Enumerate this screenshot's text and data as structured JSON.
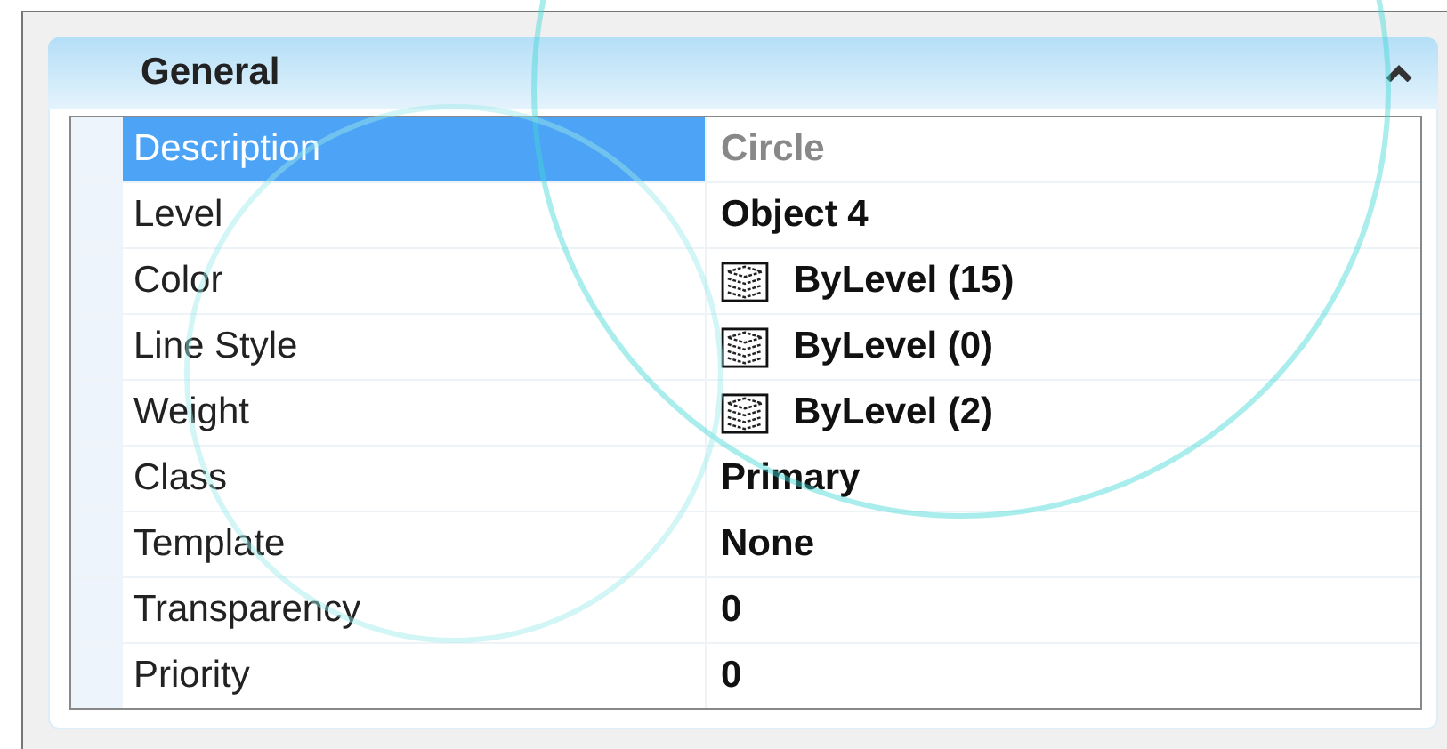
{
  "section": {
    "title": "General",
    "expanded": true
  },
  "properties": [
    {
      "label": "Description",
      "value": "Circle",
      "selected": true,
      "disabled": true,
      "kind": "text"
    },
    {
      "label": "Level",
      "value": "Object 4",
      "selected": false,
      "disabled": false,
      "kind": "text"
    },
    {
      "label": "Color",
      "value": "ByLevel (15)",
      "selected": false,
      "disabled": false,
      "kind": "bylevel"
    },
    {
      "label": "Line Style",
      "value": "ByLevel (0)",
      "selected": false,
      "disabled": false,
      "kind": "bylevel"
    },
    {
      "label": "Weight",
      "value": "ByLevel (2)",
      "selected": false,
      "disabled": false,
      "kind": "bylevel"
    },
    {
      "label": "Class",
      "value": "Primary",
      "selected": false,
      "disabled": false,
      "kind": "text"
    },
    {
      "label": "Template",
      "value": "None",
      "selected": false,
      "disabled": false,
      "kind": "text"
    },
    {
      "label": "Transparency",
      "value": "0",
      "selected": false,
      "disabled": false,
      "kind": "text"
    },
    {
      "label": "Priority",
      "value": "0",
      "selected": false,
      "disabled": false,
      "kind": "text"
    }
  ]
}
